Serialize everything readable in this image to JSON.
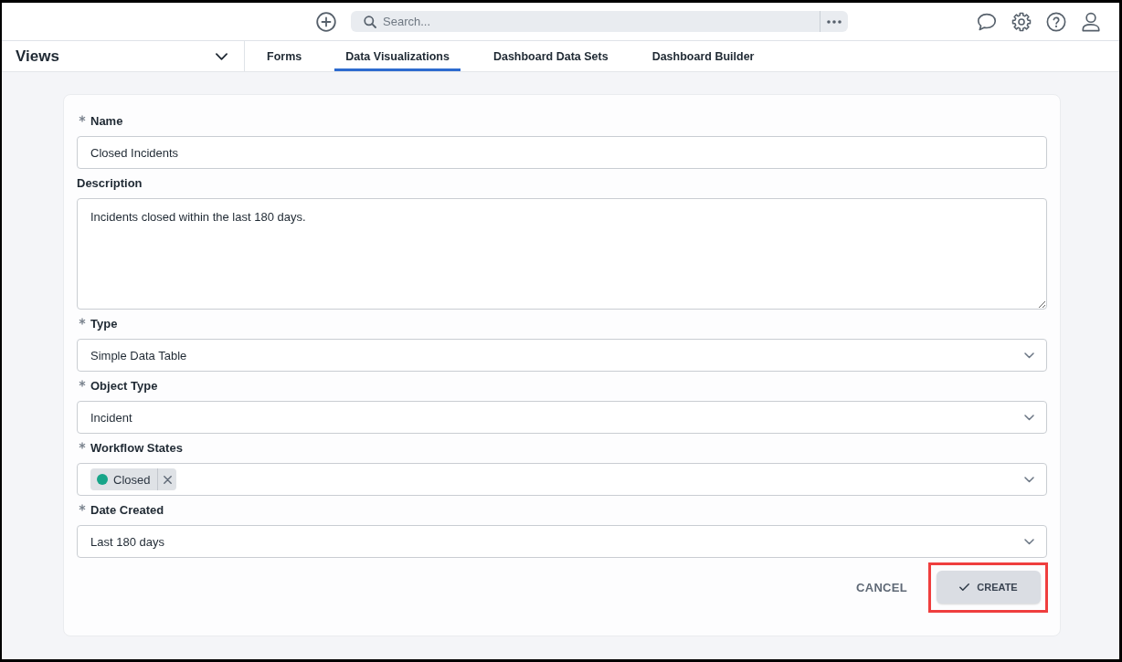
{
  "top_bar": {
    "search": {
      "placeholder": "Search..."
    }
  },
  "nav": {
    "views_label": "Views",
    "tabs": [
      {
        "label": "Forms",
        "selected": false
      },
      {
        "label": "Data Visualizations",
        "selected": true
      },
      {
        "label": "Dashboard Data Sets",
        "selected": false
      },
      {
        "label": "Dashboard Builder",
        "selected": false
      }
    ]
  },
  "form": {
    "fields": [
      {
        "kind": "text",
        "label": "Name",
        "required": true,
        "value": "Closed Incidents"
      },
      {
        "kind": "textarea",
        "label": "Description",
        "required": false,
        "value": "Incidents closed within the last 180 days."
      },
      {
        "kind": "select",
        "label": "Type",
        "required": true,
        "value": "Simple Data Table"
      },
      {
        "kind": "select",
        "label": "Object Type",
        "required": true,
        "value": "Incident"
      },
      {
        "kind": "multiselect",
        "label": "Workflow States",
        "required": true,
        "chips": [
          {
            "label": "Closed",
            "color": "#17a589"
          }
        ]
      },
      {
        "kind": "select",
        "label": "Date Created",
        "required": true,
        "value": "Last 180 days"
      }
    ],
    "buttons": [
      {
        "kind": "text",
        "label": "CANCEL",
        "highlighted": false
      },
      {
        "kind": "primary",
        "label": "CREATE",
        "highlighted": true
      }
    ]
  }
}
